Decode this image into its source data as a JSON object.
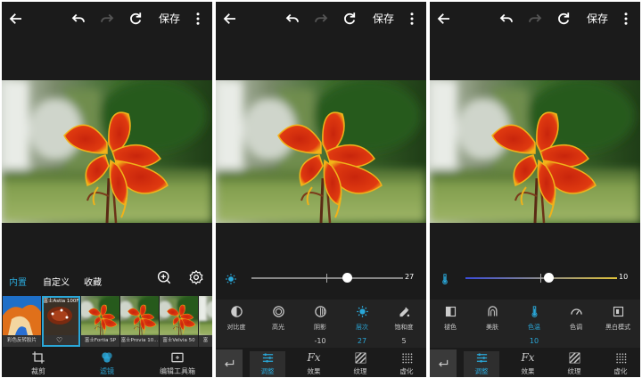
{
  "colors": {
    "accent": "#2aa7d8",
    "background": "#1b1b1b",
    "toolbar": "#232323"
  },
  "topbar": {
    "save_label": "保存"
  },
  "panel1": {
    "filter_tabs": [
      "内置",
      "自定义",
      "收藏"
    ],
    "thumbnails": [
      {
        "label": "彩色反转胶片"
      },
      {
        "label": "富士Astia 100F"
      },
      {
        "label": "富士Fortia SP"
      },
      {
        "label": "富士Provia 10..."
      },
      {
        "label": "富士Velvia 50"
      },
      {
        "label": "富"
      }
    ],
    "bottom_nav": [
      {
        "label": "裁剪",
        "icon": "crop-icon"
      },
      {
        "label": "滤镜",
        "icon": "filter-icon"
      },
      {
        "label": "编辑工具箱",
        "icon": "toolbox-icon"
      }
    ]
  },
  "panel2": {
    "slider_value": "27",
    "slider_level": 27,
    "tools": [
      {
        "label": "对比度",
        "value": "",
        "icon": "contrast-icon"
      },
      {
        "label": "高光",
        "value": "",
        "icon": "highlight-icon"
      },
      {
        "label": "阴影",
        "value": "-10",
        "icon": "shadow-icon"
      },
      {
        "label": "层次",
        "value": "27",
        "icon": "levels-icon"
      },
      {
        "label": "饱和度",
        "value": "5",
        "icon": "saturation-icon"
      }
    ],
    "bottom_nav": [
      "调整",
      "效果",
      "纹理",
      "虚化"
    ]
  },
  "panel3": {
    "slider_value": "10",
    "slider_level": 10,
    "tools": [
      {
        "label": "褪色",
        "value": "",
        "icon": "fade-icon"
      },
      {
        "label": "美肤",
        "value": "",
        "icon": "skin-icon"
      },
      {
        "label": "色温",
        "value": "10",
        "icon": "temperature-icon"
      },
      {
        "label": "色调",
        "value": "",
        "icon": "tint-icon"
      },
      {
        "label": "黑白模式",
        "value": "",
        "icon": "bw-mode-icon"
      }
    ],
    "bottom_nav": [
      "调整",
      "效果",
      "纹理",
      "虚化"
    ]
  }
}
